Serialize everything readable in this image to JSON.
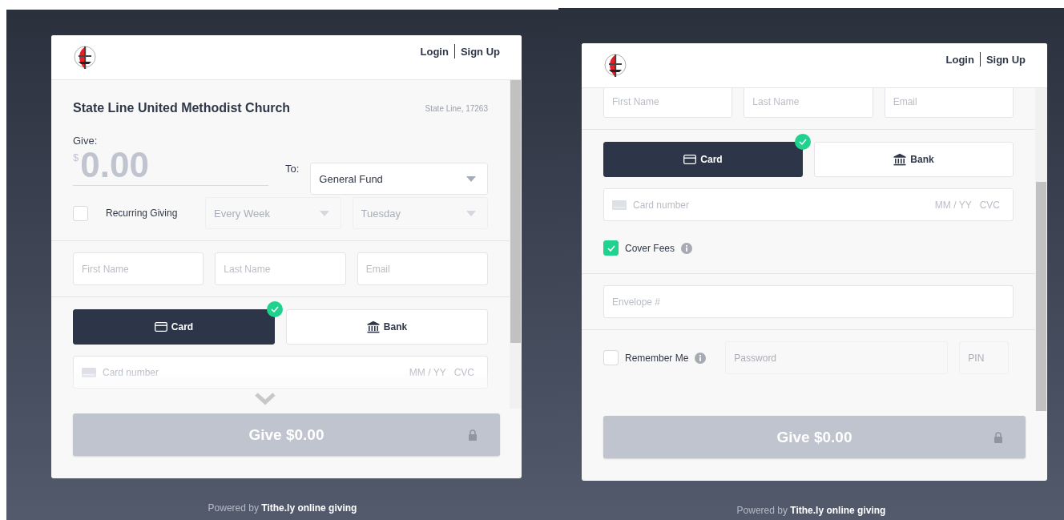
{
  "panels": [
    {
      "header_links": [
        "Login",
        "Sign Up"
      ],
      "more_below": true,
      "groups": [
        [
          {
            "kind": "church",
            "name": "State Line United Methodist Church",
            "location": "State Line, 17263"
          },
          {
            "kind": "amount",
            "label": "Give:",
            "currency": "$",
            "value": "0.00",
            "to_label": "To:",
            "fund": "General Fund"
          },
          {
            "kind": "recurring",
            "checked": false,
            "label": "Recurring Giving",
            "frequency": "Every Week",
            "day": "Tuesday"
          }
        ],
        [
          {
            "kind": "names",
            "placeholders": [
              "First Name",
              "Last Name",
              "Email"
            ]
          }
        ],
        [
          {
            "kind": "payment",
            "methods": [
              {
                "label": "Card",
                "selected": true
              },
              {
                "label": "Bank",
                "selected": false
              }
            ]
          },
          {
            "kind": "card_field",
            "placeholder": "Card number",
            "expiry": "MM / YY",
            "cvc": "CVC"
          }
        ]
      ],
      "give_button": "Give $0.00",
      "footer": "Powered by **Tithe.ly online giving**"
    },
    {
      "header_links": [
        "Login",
        "Sign Up"
      ],
      "more_below": false,
      "groups": [
        [
          {
            "kind": "names",
            "placeholders": [
              "First Name",
              "Last Name",
              "Email"
            ]
          }
        ],
        [
          {
            "kind": "payment",
            "methods": [
              {
                "label": "Card",
                "selected": true
              },
              {
                "label": "Bank",
                "selected": false
              }
            ]
          },
          {
            "kind": "card_field",
            "placeholder": "Card number",
            "expiry": "MM / YY",
            "cvc": "CVC"
          },
          {
            "kind": "cover_fees",
            "checked": true,
            "label": "Cover Fees"
          }
        ],
        [
          {
            "kind": "envelope",
            "placeholder": "Envelope #"
          }
        ],
        [
          {
            "kind": "remember",
            "checked": false,
            "label": "Remember Me",
            "password_placeholder": "Password",
            "pin_placeholder": "PIN"
          }
        ]
      ],
      "give_button": "Give $0.00",
      "footer": "Powered by **Tithe.ly online giving**"
    }
  ]
}
